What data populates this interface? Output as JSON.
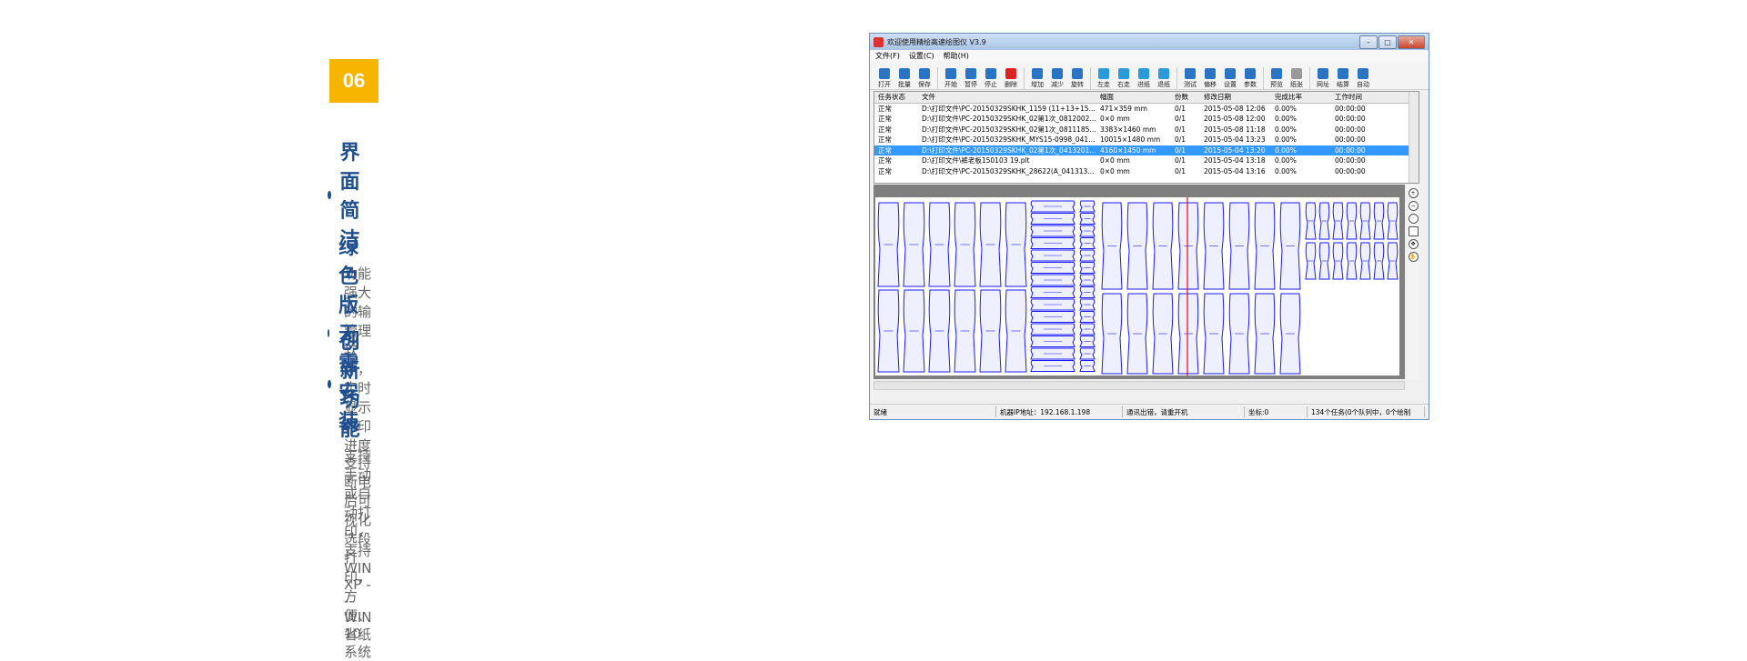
{
  "badge": "06",
  "features": [
    {
      "title": "界面简洁",
      "desc": "功能强大的输管理软件，实时显示打印进度"
    },
    {
      "title": "绿色版无需安装",
      "desc": "支持手动或自动打印，支持WIN XP ---  WIN 10系统"
    },
    {
      "title": "创新功能",
      "desc": "支持断电后可视化选段打印，方便、省纸"
    }
  ],
  "window": {
    "title": "欢迎使用精绘高速绘图仪 V3.9",
    "menu": [
      "文件(F)",
      "设置(C)",
      "帮助(H)"
    ],
    "toolbar": [
      "打开",
      "批量",
      "保存",
      "开始",
      "暂停",
      "停止",
      "删除",
      "增加",
      "减少",
      "旋转",
      "左走",
      "右走",
      "进纸",
      "退纸",
      "测试",
      "偏移",
      "设置",
      "参数",
      "预览",
      "纸张",
      "网址",
      "结算",
      "自动"
    ],
    "columns": [
      "任务状态",
      "文件",
      "幅面",
      "份数",
      "修改日期",
      "完成比率",
      "工作时间"
    ],
    "rows": [
      [
        "正常",
        "D:\\打印文件\\PC-20150329SKHK_1159  (11+13+15...",
        "471×359 mm",
        "0/1",
        "2015-05-08 12:06",
        "0.00%",
        "00:00:00"
      ],
      [
        "正常",
        "D:\\打印文件\\PC-20150329SKHK_02第1次_0812002...",
        "0×0 mm",
        "0/1",
        "2015-05-08 12:00",
        "0.00%",
        "00:00:00"
      ],
      [
        "正常",
        "D:\\打印文件\\PC-20150329SKHK_02第1次_0811185...",
        "3383×1460 mm",
        "0/1",
        "2015-05-08 11:18",
        "0.00%",
        "00:00:00"
      ],
      [
        "正常",
        "D:\\打印文件\\PC-20150329SKHK_MYS15-0998_041...",
        "10015×1480 mm",
        "0/1",
        "2015-05-04 13:23",
        "0.00%",
        "00:00:00"
      ],
      [
        "正常",
        "D:\\打印文件\\PC-20150329SKHK_02第1次_0413201...",
        "4160×1450 mm",
        "0/1",
        "2015-05-04 13:20",
        "0.00%",
        "00:00:00"
      ],
      [
        "正常",
        "D:\\打印文件\\裤老板150103 19.plt",
        "0×0 mm",
        "0/1",
        "2015-05-04 13:18",
        "0.00%",
        "00:00:00"
      ],
      [
        "正常",
        "D:\\打印文件\\PC-20150329SKHK_28622(A_041313...",
        "0×0 mm",
        "0/1",
        "2015-05-04 13:16",
        "0.00%",
        "00:00:00"
      ]
    ],
    "selected_row": 4,
    "status": [
      "就绪",
      "机器IP地址：192.168.1.198",
      "通讯出错，请重开机",
      "坐标:0",
      "134个任务(0个队列中，0个绘制"
    ]
  },
  "colors": {
    "badge": "#f7b500",
    "title": "#1f4f8f",
    "pattern": "#1a1aff"
  }
}
